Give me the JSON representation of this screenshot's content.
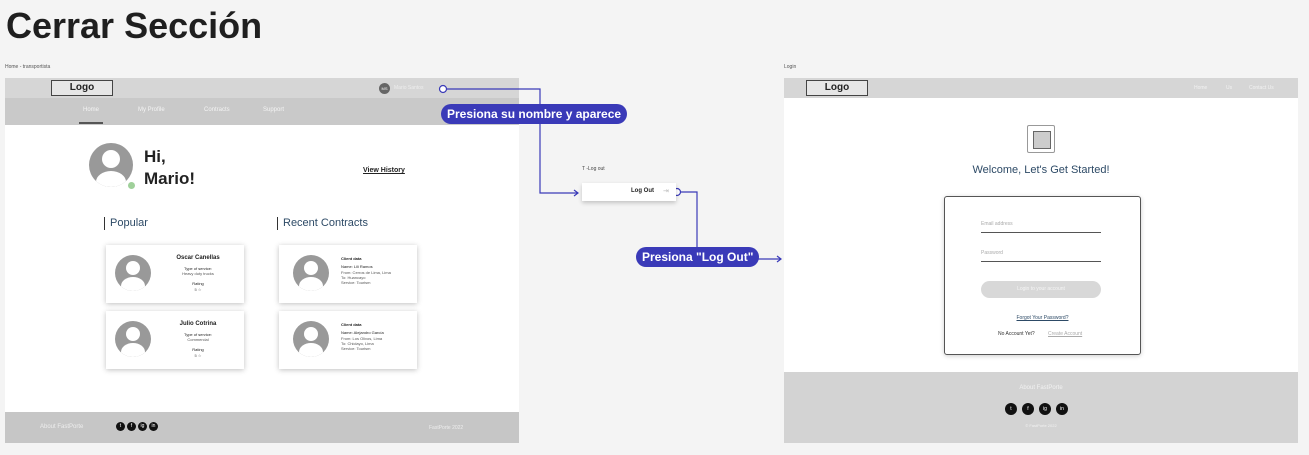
{
  "page_title": "Cerrar Sección",
  "home": {
    "frame_label": "Home - transportista",
    "logo": "Logo",
    "user_chip": "MS",
    "user_name": "Mario Santos",
    "nav": [
      "Home",
      "My Profile",
      "Contracts",
      "Support"
    ],
    "greeting_1": "Hi,",
    "greeting_2": "Mario!",
    "view_history": "View History",
    "popular_title": "Popular",
    "recent_title": "Recent Contracts",
    "popular_cards": [
      {
        "name": "Oscar Canellas",
        "service_label": "Type of service:",
        "service": "Heavy duty trucks",
        "rating_label": "Rating",
        "rating": "5 ☆"
      },
      {
        "name": "Julio Cotrina",
        "service_label": "Type of service:",
        "service": "Commercial",
        "rating_label": "Rating",
        "rating": "5 ☆"
      }
    ],
    "recent_cards": [
      {
        "title": "Client data",
        "name": "Name: Lili Ramos",
        "from": "From: Cerros de Lima, Lima",
        "to": "To: Huancayo",
        "service": "Service: Tourism"
      },
      {
        "title": "Client data",
        "name": "Name: Alejandro García",
        "from": "From: Los Olivos, Lima",
        "to": "To: Chiclayo, Lima",
        "service": "Service: Tourism"
      }
    ],
    "footer_about": "About FastPorte",
    "footer_copy": "FastPorte 2022",
    "social": [
      "t",
      "f",
      "ig",
      "in"
    ]
  },
  "middle": {
    "badge_1": "Presiona su nombre y aparece",
    "dropdown_label": "T -Log out",
    "logout": "Log Out",
    "badge_2": "Presiona \"Log Out\""
  },
  "login": {
    "frame_label": "Login",
    "logo": "Logo",
    "nav": [
      "Home",
      "Us",
      "Contact Us"
    ],
    "welcome": "Welcome, Let's Get Started!",
    "email_placeholder": "Email address",
    "password_placeholder": "Password",
    "login_button": "Login to your account",
    "forgot": "Forgot Your Password?",
    "no_account": "No Account Yet?",
    "create_account": "Create Account",
    "footer_about": "About FastPorte",
    "footer_copy": "© FastPorte 2022",
    "social": [
      "t",
      "f",
      "ig",
      "in"
    ]
  },
  "colors": {
    "accent": "#3a3ab8",
    "header_gray": "#d6d6d6",
    "footer_gray": "#c6c6c6"
  }
}
